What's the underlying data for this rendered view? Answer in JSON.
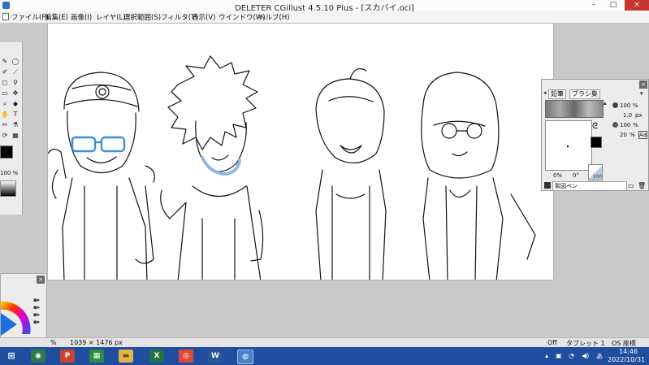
{
  "window": {
    "title": "DELETER CGillust 4.5.10 Plus - [スカバイ.oci]",
    "minimize": "–",
    "maximize": "□",
    "close": "×"
  },
  "menu": [
    {
      "label": "ファイル(F)"
    },
    {
      "label": "編集(E)"
    },
    {
      "label": "画像(I)"
    },
    {
      "label": "レイヤ(L)"
    },
    {
      "label": "選択範囲(S)"
    },
    {
      "label": "フィルタ(T)"
    },
    {
      "label": "表示(V)"
    },
    {
      "label": "ウインドウ(W)"
    },
    {
      "label": "ヘルプ(H)"
    }
  ],
  "toolpanel": {
    "opacity": "100 %"
  },
  "brush_panel": {
    "tabs": [
      "鉛筆",
      "ブラシ集"
    ],
    "opacity_1": "100",
    "size_value": "1.0",
    "size_unit": "px",
    "opacity_2": "100",
    "density": "20",
    "percent": "%",
    "angle_left": "0%",
    "angle_right": "0°",
    "preview_value": "100",
    "preset_name": "製図ペン"
  },
  "status": {
    "zoom": "%",
    "size": "1039 × 1476 px",
    "off": "Off",
    "tablet": "タブレット 1",
    "os_coords": "OS 座標"
  },
  "taskbar": {
    "time": "14:46",
    "date": "2022/10/31",
    "ime": "あ"
  },
  "colors": {
    "taskbar": "#1f4ea0",
    "close_button": "#c7372f",
    "glasses_blue": "#3a8fdc"
  }
}
